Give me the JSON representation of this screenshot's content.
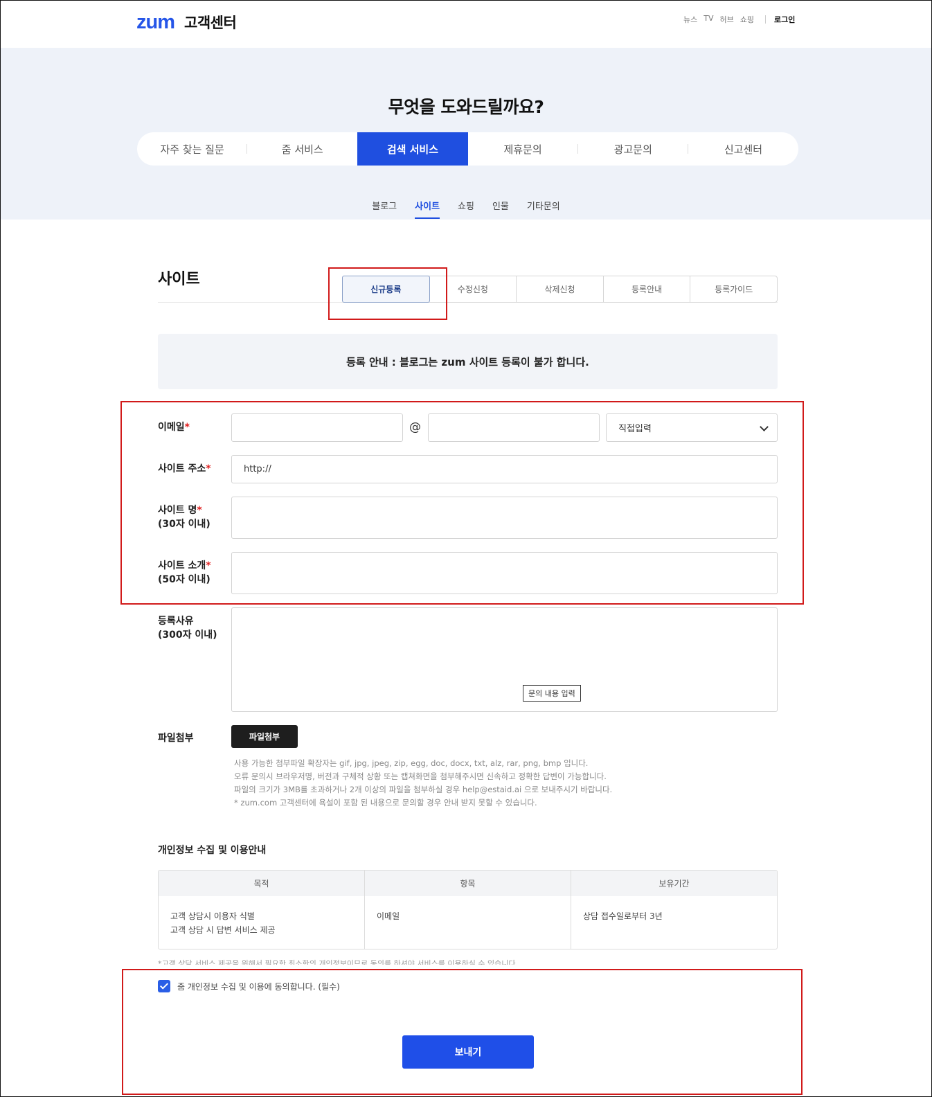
{
  "header": {
    "logo": "zum",
    "title": "고객센터",
    "links": [
      "뉴스",
      "TV",
      "허브",
      "쇼핑"
    ],
    "login": "로그인"
  },
  "hero": {
    "title": "무엇을 도와드릴까요?",
    "main_tabs": [
      "자주 찾는 질문",
      "줌 서비스",
      "검색 서비스",
      "제휴문의",
      "광고문의",
      "신고센터"
    ],
    "main_tab_active": "검색 서비스",
    "sub_tabs": [
      "블로그",
      "사이트",
      "쇼핑",
      "인물",
      "기타문의"
    ],
    "sub_tab_active": "사이트"
  },
  "section": {
    "title": "사이트",
    "seg_tabs": [
      "신규등록",
      "수정신청",
      "삭제신청",
      "등록안내",
      "등록가이드"
    ],
    "seg_tab_active": "신규등록"
  },
  "notice": "등록 안내 : 블로그는 zum 사이트 등록이 불가 합니다.",
  "form": {
    "email_label": "이메일",
    "at_symbol": "@",
    "email_domain_select": "직접입력",
    "site_url_label": "사이트 주소",
    "site_url_value": "http://",
    "site_name_label": "사이트 명",
    "site_name_sub": "(30자 이내)",
    "site_intro_label": "사이트 소개",
    "site_intro_sub": "(50자 이내)",
    "reason_label": "등록사유",
    "reason_sub": "(300자 이내)",
    "reason_tooltip": "문의 내용 입력",
    "required_mark": "*",
    "file_label": "파일첨부",
    "file_button": "파일첨부",
    "file_notes": [
      "사용 가능한 첨부파일 확장자는 gif, jpg, jpeg, zip, egg, doc, docx, txt, alz, rar, png, bmp 입니다.",
      "오류 문의시 브라우저명, 버전과 구체적 상황 또는 캡쳐화면을 첨부해주시면 신속하고 정확한 답변이 가능합니다.",
      "파일의 크기가 3MB를 초과하거나 2개 이상의 파일을 첨부하실 경우 help@estaid.ai 으로 보내주시기 바랍니다.",
      "* zum.com 고객센터에 욕설이 포함 된 내용으로 문의할 경우 안내 받지 못할 수 있습니다."
    ]
  },
  "privacy": {
    "title": "개인정보 수집 및 이용안내",
    "headers": [
      "목적",
      "항목",
      "보유기간"
    ],
    "purpose_lines": [
      "고객 상담시 이용자 식별",
      "고객 상담 시 답변 서비스 제공"
    ],
    "item": "이메일",
    "period": "상담 접수일로부터 3년",
    "footnote": "*고객 상담 서비스 제공을 위해서 필요한 최소한의 개인정보이므로 동의를 하셔야 서비스를 이용하실 수 있습니다.",
    "agree_text": "줌 개인정보 수집 및 이용에 동의합니다. (필수)",
    "agree_checked": true
  },
  "submit_label": "보내기",
  "colors": {
    "brand": "#2555e8",
    "active_tab": "#1f4fe0",
    "highlight_box": "#d11a1a"
  }
}
